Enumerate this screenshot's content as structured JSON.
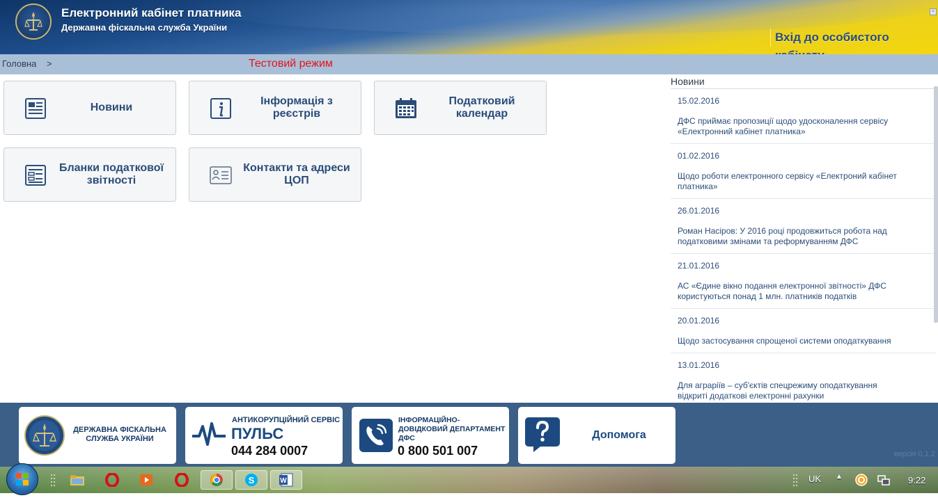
{
  "header": {
    "title": "Електронний кабінет платника",
    "subtitle": "Державна фіскальна служба України",
    "login_label": "Вхід до особистого кабінету"
  },
  "breadcrumb": {
    "home": "Головна",
    "separator": ">"
  },
  "test_mode_label": "Тестовий режим",
  "tiles": [
    {
      "label": "Новини",
      "icon": "newspaper-icon"
    },
    {
      "label": "Інформація з реєстрів",
      "icon": "info-icon"
    },
    {
      "label": "Податковий календар",
      "icon": "calendar-icon"
    },
    {
      "label": "Бланки податкової звітності",
      "icon": "forms-icon"
    },
    {
      "label": "Контакти та адреси ЦОП",
      "icon": "contact-card-icon"
    }
  ],
  "news": {
    "heading": "Новини",
    "items": [
      {
        "date": "15.02.2016",
        "text": "ДФС приймає пропозиції щодо удосконалення сервісу «Електронний кабінет платника»"
      },
      {
        "date": "01.02.2016",
        "text": "Щодо роботи електронного сервісу «Електроний кабінет платника»"
      },
      {
        "date": "26.01.2016",
        "text": "Роман Насіров: У 2016 році продовжиться робота над податковими змінами та реформуванням ДФС"
      },
      {
        "date": "21.01.2016",
        "text": "АС «Єдине вікно подання електронної звітності» ДФС користуються понад 1 млн. платників податків"
      },
      {
        "date": "20.01.2016",
        "text": "Щодо застосування спрощеної системи оподаткування"
      },
      {
        "date": "13.01.2016",
        "text": "Для аграріїв – суб'єктів спецрежиму оподаткування відкриті додаткові електронні рахунки"
      }
    ]
  },
  "footer": {
    "dfs_line1": "ДЕРЖАВНА ФІСКАЛЬНА",
    "dfs_line2": "СЛУЖБА УКРАЇНИ",
    "puls_caption": "АНТИКОРУПЦІЙНИЙ СЕРВІС",
    "puls_name": "ПУЛЬС",
    "puls_phone": "044 284 0007",
    "info_line1": "ІНФОРМАЦІЙНО-",
    "info_line2": "ДОВІДКОВИЙ ДЕПАРТАМЕНТ",
    "info_line3": "ДФС",
    "info_phone": "0 800 501 007",
    "help_label": "Допомога",
    "version": "версія 0.1.2"
  },
  "taskbar": {
    "language": "UK",
    "clock": "9:22"
  },
  "colors": {
    "accent": "#2b4d78",
    "test_mode": "#e3131b",
    "footer_bg": "#3b5f87",
    "crumb_bar": "#a9bfd8"
  }
}
